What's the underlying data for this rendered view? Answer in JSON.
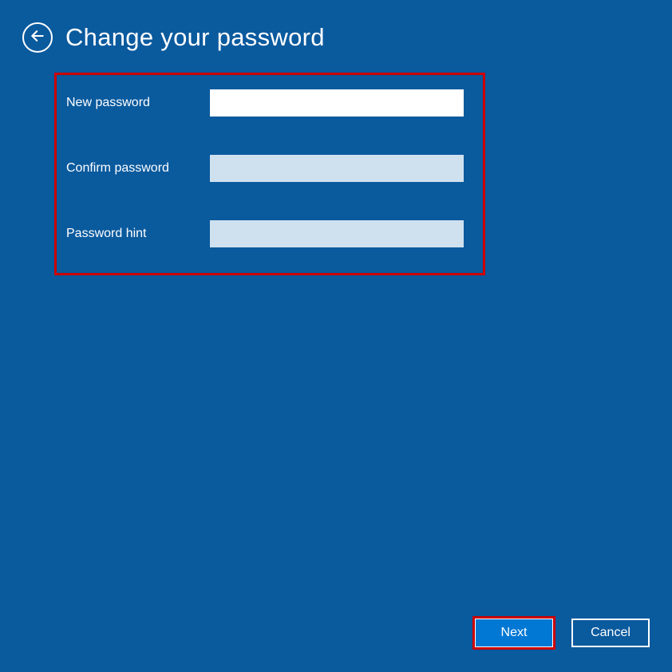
{
  "header": {
    "title": "Change your password"
  },
  "form": {
    "new_password": {
      "label": "New password",
      "value": ""
    },
    "confirm_password": {
      "label": "Confirm password",
      "value": ""
    },
    "password_hint": {
      "label": "Password hint",
      "value": ""
    }
  },
  "buttons": {
    "next": "Next",
    "cancel": "Cancel"
  },
  "colors": {
    "background": "#0a5a9e",
    "highlight_border": "#cc0000",
    "primary_button": "#0078d4",
    "input_inactive": "#cfe0ef",
    "input_active": "#ffffff"
  }
}
